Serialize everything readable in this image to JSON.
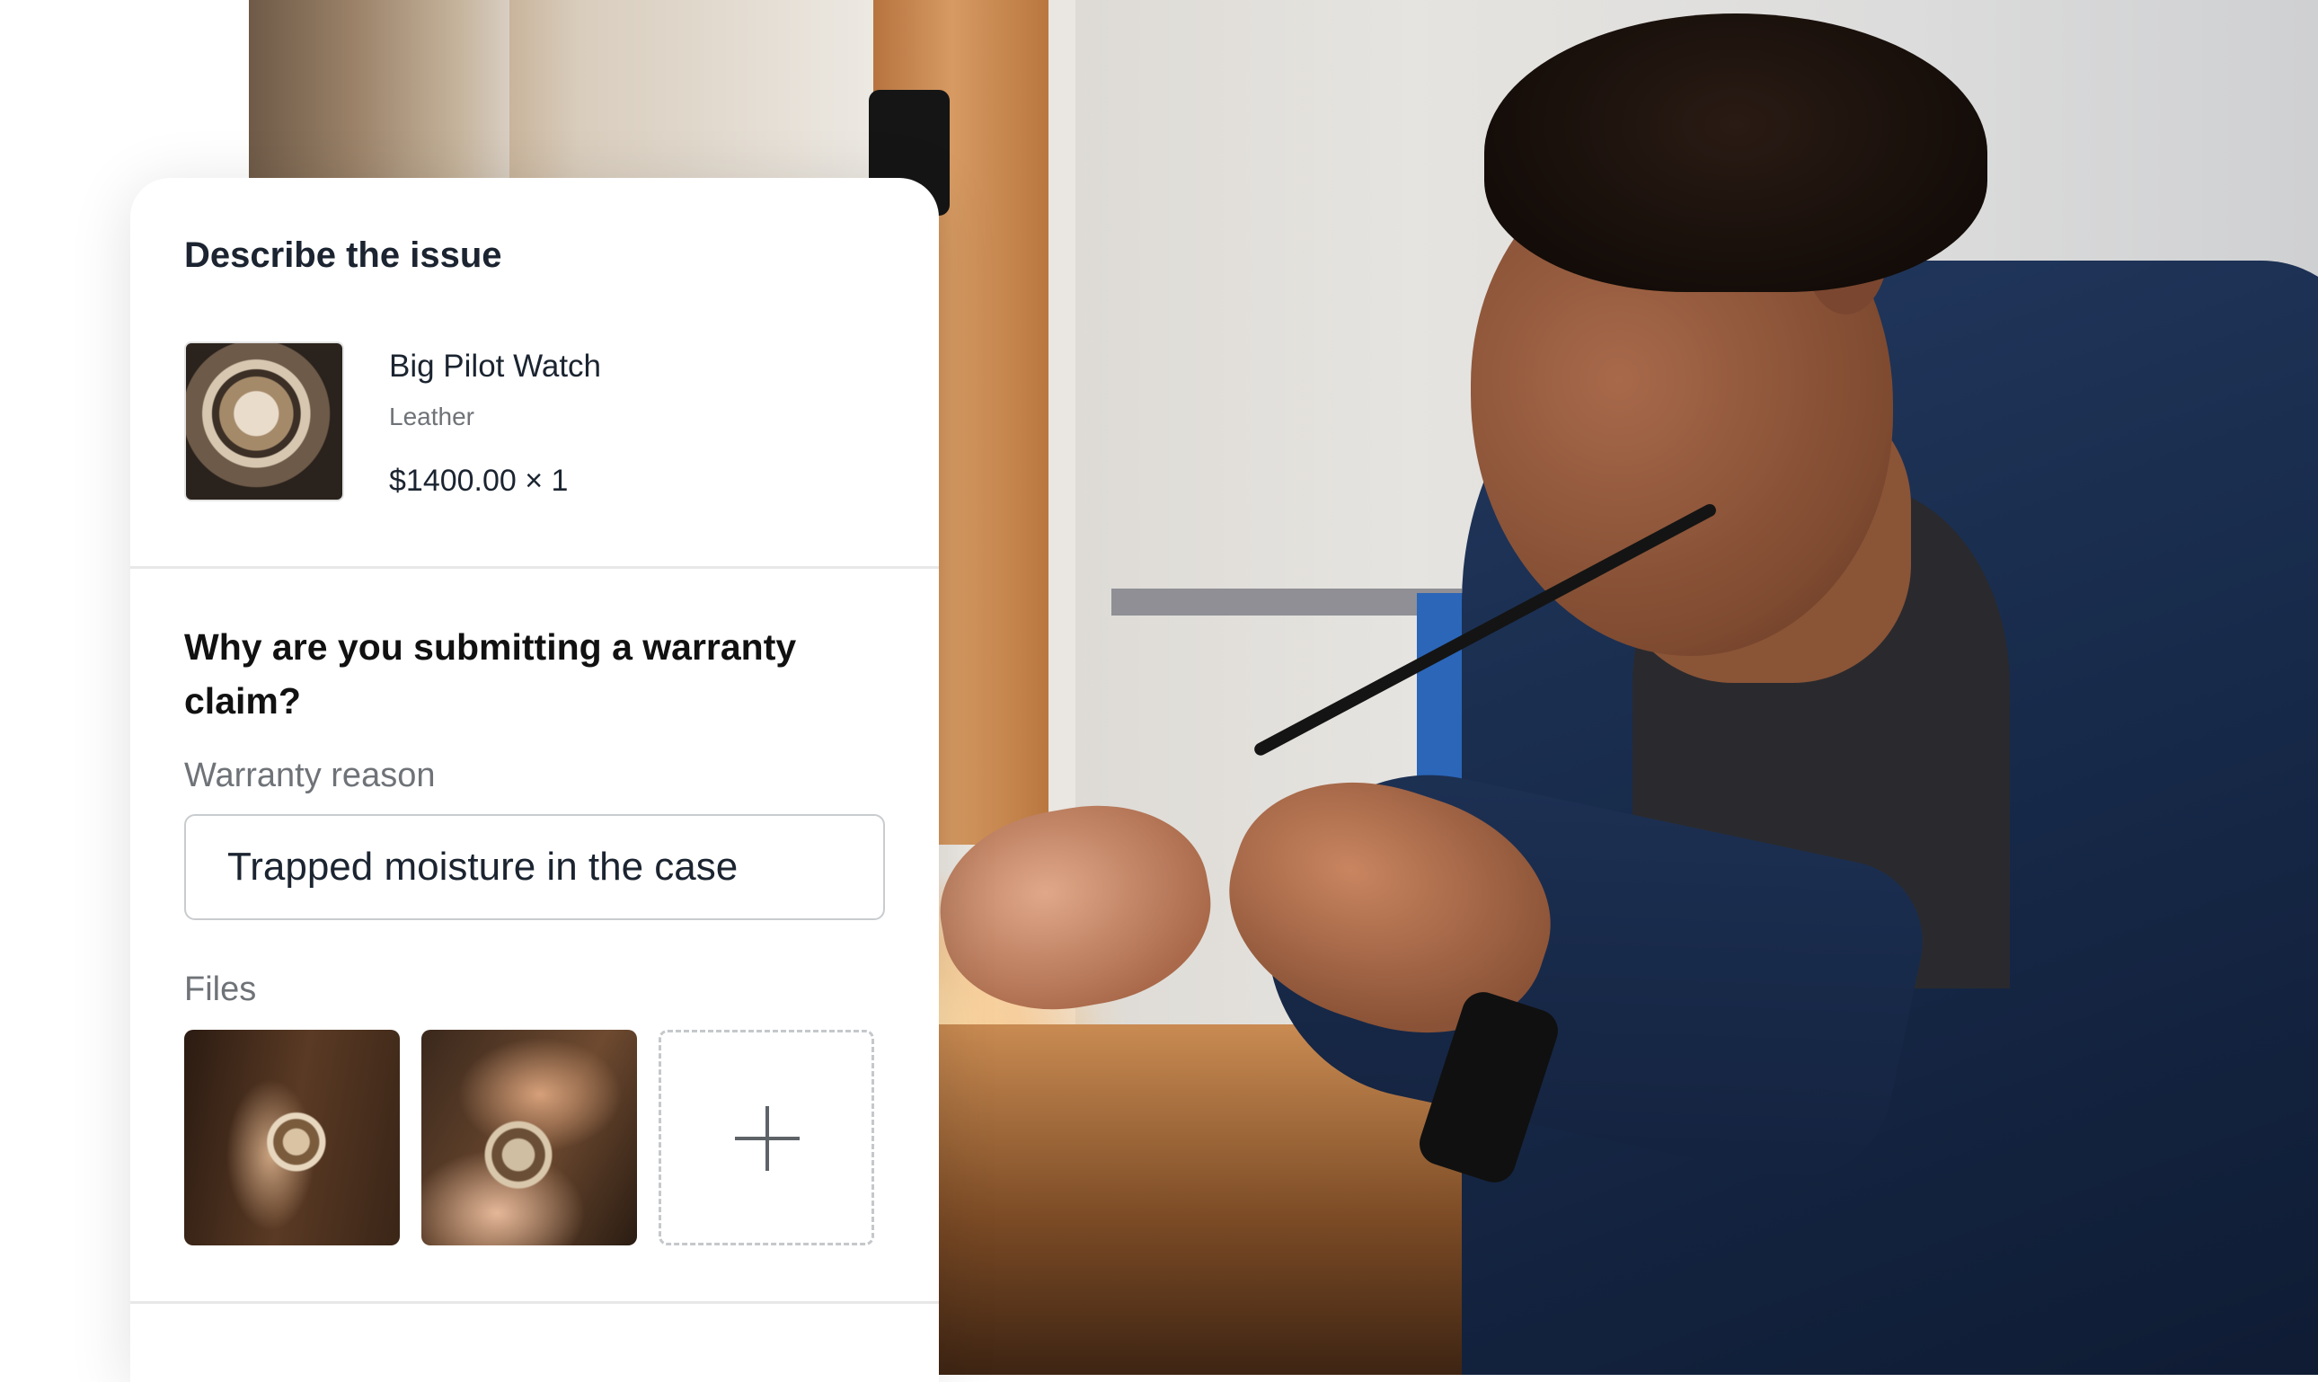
{
  "card": {
    "title": "Describe the issue",
    "product": {
      "name": "Big Pilot Watch",
      "variant": "Leather",
      "price": "$1400.00 × 1",
      "thumbnail_icon": "watch-photo"
    },
    "question": "Why are you submitting a warranty claim?",
    "warranty_reason": {
      "label": "Warranty reason",
      "value": "Trapped moisture in the case"
    },
    "files": {
      "label": "Files",
      "items": [
        "watch-in-hand-photo",
        "watch-movement-photo"
      ],
      "add_icon": "plus-icon"
    }
  },
  "background": {
    "scene": "watchmaker-at-workbench-photo"
  },
  "colors": {
    "heading": "#1b2430",
    "muted": "#6f7378",
    "border": "#c9cccf"
  }
}
